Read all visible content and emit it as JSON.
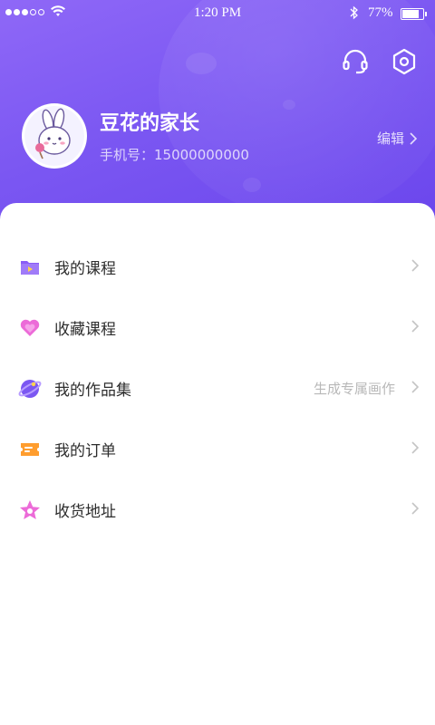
{
  "status_bar": {
    "time": "1:20 PM",
    "battery_percent": "77%",
    "battery_level": 0.77
  },
  "header": {
    "support_icon": "headset-icon",
    "settings_icon": "hexagon-settings-icon",
    "avatar_icon": "bunny-avatar",
    "user_name": "豆花的家长",
    "phone_label": "手机号：15000000000",
    "edit_label": "编辑"
  },
  "menu": {
    "items": [
      {
        "label": "我的课程",
        "hint": "",
        "icon": "course-folder-icon",
        "color": "#8a5cf6"
      },
      {
        "label": "收藏课程",
        "hint": "",
        "icon": "heart-icon",
        "color": "#ec6bd8"
      },
      {
        "label": "我的作品集",
        "hint": "生成专属画作",
        "icon": "planet-icon",
        "color": "#7b57f2"
      },
      {
        "label": "我的订单",
        "hint": "",
        "icon": "ticket-icon",
        "color": "#ff9d2e"
      },
      {
        "label": "收货地址",
        "hint": "",
        "icon": "star-icon",
        "color": "#ec6bd8"
      }
    ]
  },
  "colors": {
    "header_start": "#8f68f7",
    "header_end": "#6a45ec",
    "text_primary": "#2d2d2d",
    "text_hint": "#b8b8b8"
  }
}
